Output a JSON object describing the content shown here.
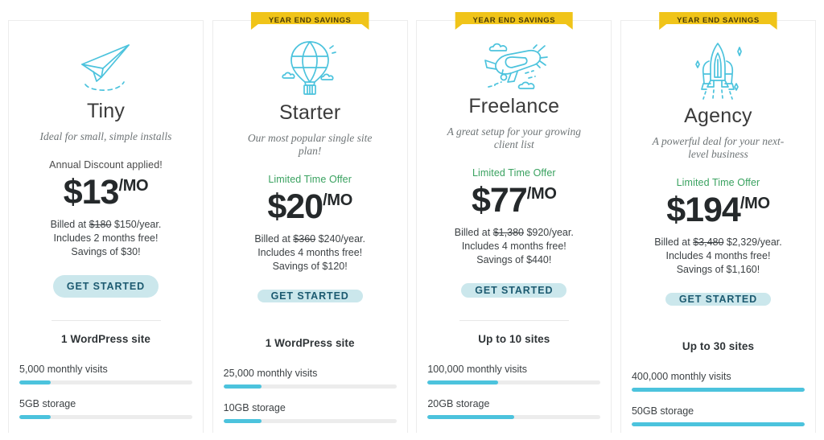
{
  "badge_label": "YEAR END SAVINGS",
  "colors": {
    "badge_bg": "#f0c419",
    "accent_cyan": "#4cc3dd",
    "offer_green": "#3aa260",
    "button_bg": "#cbe7ec",
    "button_text": "#1c5a70",
    "meter_track": "#ececec"
  },
  "plans": [
    {
      "id": "tiny",
      "badge": "",
      "icon": "paper-plane-icon",
      "name": "Tiny",
      "tagline": "Ideal for small, simple installs",
      "offer_label": "Annual Discount applied!",
      "offer_style": "dark",
      "price": "$13",
      "price_suffix": "/MO",
      "billed_prefix": "Billed at",
      "billed_old": "$180",
      "billed_new": "$150/year.",
      "months_free": "Includes 2 months free!",
      "savings": "Savings of $30!",
      "cta": "GET STARTED",
      "sites": "1 WordPress site",
      "meters": [
        {
          "label": "5,000 monthly visits",
          "percent": 18
        },
        {
          "label": "5GB storage",
          "percent": 18
        }
      ]
    },
    {
      "id": "starter",
      "badge": "YEAR END SAVINGS",
      "icon": "hot-air-balloon-icon",
      "name": "Starter",
      "tagline": "Our most popular single site plan!",
      "offer_label": "Limited Time Offer",
      "offer_style": "green",
      "price": "$20",
      "price_suffix": "/MO",
      "billed_prefix": "Billed at",
      "billed_old": "$360",
      "billed_new": "$240/year.",
      "months_free": "Includes 4 months free!",
      "savings": "Savings of $120!",
      "cta": "GET STARTED",
      "sites": "1 WordPress site",
      "meters": [
        {
          "label": "25,000 monthly visits",
          "percent": 22
        },
        {
          "label": "10GB storage",
          "percent": 22
        }
      ]
    },
    {
      "id": "freelance",
      "badge": "YEAR END SAVINGS",
      "icon": "propeller-plane-icon",
      "name": "Freelance",
      "tagline": "A great setup for your growing client list",
      "offer_label": "Limited Time Offer",
      "offer_style": "green",
      "price": "$77",
      "price_suffix": "/MO",
      "billed_prefix": "Billed at",
      "billed_old": "$1,380",
      "billed_new": "$920/year.",
      "months_free": "Includes 4 months free!",
      "savings": "Savings of $440!",
      "cta": "GET STARTED",
      "sites": "Up to 10 sites",
      "meters": [
        {
          "label": "100,000 monthly visits",
          "percent": 41
        },
        {
          "label": "20GB storage",
          "percent": 50
        }
      ]
    },
    {
      "id": "agency",
      "badge": "YEAR END SAVINGS",
      "icon": "space-shuttle-icon",
      "name": "Agency",
      "tagline": "A powerful deal for your next-level business",
      "offer_label": "Limited Time Offer",
      "offer_style": "green",
      "price": "$194",
      "price_suffix": "/MO",
      "billed_prefix": "Billed at",
      "billed_old": "$3,480",
      "billed_new": "$2,329/year.",
      "months_free": "Includes 4 months free!",
      "savings": "Savings of $1,160!",
      "cta": "GET STARTED",
      "sites": "Up to 30 sites",
      "meters": [
        {
          "label": "400,000 monthly visits",
          "percent": 100
        },
        {
          "label": "50GB storage",
          "percent": 100
        }
      ]
    }
  ]
}
